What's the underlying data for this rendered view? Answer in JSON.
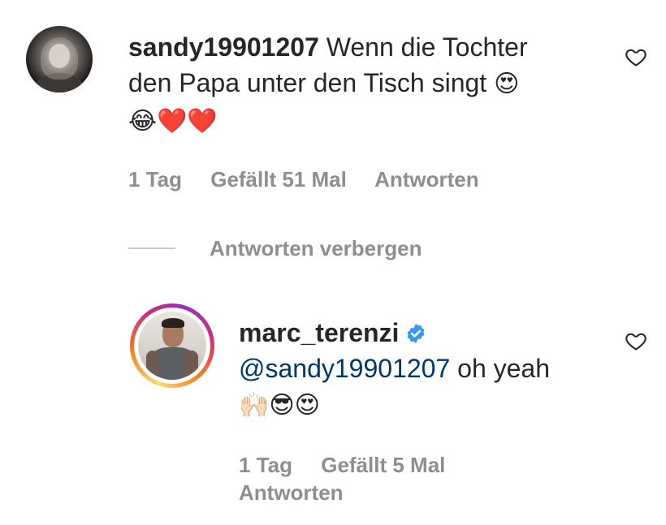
{
  "comments": [
    {
      "username": "sandy19901207",
      "text_line1": "Wenn die Tochter",
      "text_line2": "den Papa unter den Tisch singt",
      "emoji_inline": "😍",
      "emoji_line3": "😂❤️❤️",
      "age": "1 Tag",
      "likes": "Gefällt 51 Mal",
      "reply_label": "Antworten",
      "avatar_icon": "profile-photo"
    }
  ],
  "replies_toggle": {
    "label": "Antworten verbergen"
  },
  "replies": [
    {
      "username": "marc_terenzi",
      "verified": true,
      "mention": "@sandy19901207",
      "text": " oh yeah",
      "emoji_line": "🙌🏻😎😍",
      "age": "1 Tag",
      "likes": "Gefällt 5 Mal",
      "reply_label": "Antworten",
      "avatar_icon": "profile-photo-story-ring"
    }
  ],
  "icons": {
    "like": "heart-outline-icon",
    "verified": "verified-badge-icon"
  },
  "colors": {
    "text": "#262626",
    "secondary": "#8e8e8e",
    "mention": "#00376b",
    "verified": "#3897f0"
  }
}
